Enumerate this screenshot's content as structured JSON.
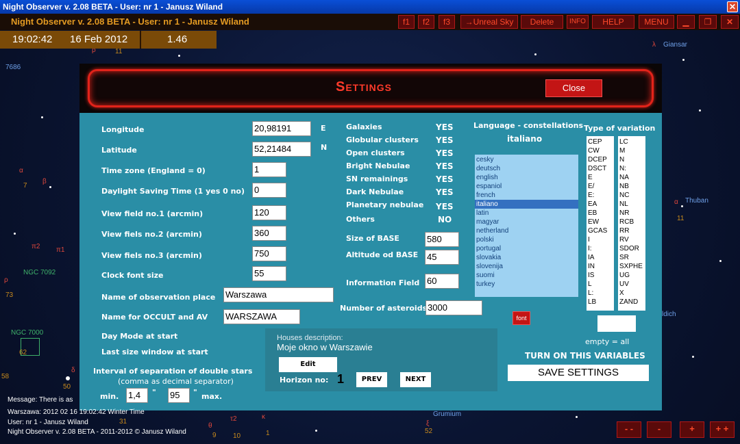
{
  "window": {
    "title": "Night Observer v. 2.08 BETA -  User:  nr 1 - Janusz Wiland"
  },
  "appbar": {
    "title": "Night Observer v. 2.08 BETA -  User:  nr 1 - Janusz Wiland",
    "buttons": [
      "f1",
      "f2",
      "f3",
      "→Unreal Sky",
      "Delete",
      "INFO",
      "HELP",
      "MENU"
    ]
  },
  "timebar": {
    "time": "19:02:42",
    "date": "16 Feb 2012",
    "value": "1.46"
  },
  "sky_labels": {
    "giansar": "Giansar",
    "lambda": "λ",
    "rho": "ρ",
    "eleven": "11",
    "n7686": "7686",
    "alpha1": "α",
    "seven": "7",
    "beta": "β",
    "pi2": "π2",
    "pi1": "π1",
    "ngc7092": "NGC 7092",
    "rho2": "ρ",
    "seventy3": "73",
    "ngc7000": "NGC 7000",
    "sixty2": "62",
    "fifty8": "58",
    "delta": "δ",
    "fifty": "50",
    "thuban": "Thuban",
    "alpha2": "α",
    "eleven2": "11",
    "dich": "ldich",
    "grumium": "Grumium",
    "xi": "ξ",
    "fifty2": "52",
    "theta": "θ",
    "tau2": "τ2",
    "kappa": "κ",
    "thirty1": "31",
    "ten": "10",
    "one": "1",
    "nine": "9"
  },
  "settings": {
    "title": "Settings",
    "close_label": "Close",
    "longitude_label": "Longitude",
    "longitude_value": "20,98191",
    "longitude_dir": "E",
    "latitude_label": "Latitude",
    "latitude_value": "52,21484",
    "latitude_dir": "N",
    "timezone_label": "Time zone (England = 0)",
    "timezone_value": "1",
    "dst_label": "Daylight Saving Time (1 yes  0 no)",
    "dst_value": "0",
    "view1_label": "View field no.1 (arcmin)",
    "view1_value": "120",
    "view2_label": "View fiels no.2 (arcmin)",
    "view2_value": "360",
    "view3_label": "View fiels no.3 (arcmin)",
    "view3_value": "750",
    "clockfont_label": "Clock font size",
    "clockfont_value": "55",
    "obsplace_label": "Name of observation place",
    "obsplace_value": "Warszawa",
    "occult_label": "Name for OCCULT and AV",
    "occult_value": "WARSZAWA",
    "daymode_label": "Day Mode at start",
    "lastsize_label": "Last size window at start",
    "doublestars_label": "Interval of separation of double stars",
    "doublestars_sub": "(comma as decimal separator)",
    "min_label": "min.",
    "min_value": "1,4",
    "min_unit": "\"",
    "max_value": "95",
    "max_unit": "\"",
    "max_label": "max.",
    "objects": [
      {
        "name": "Galaxies",
        "value": "YES"
      },
      {
        "name": "Globular clusters",
        "value": "YES"
      },
      {
        "name": "Open clusters",
        "value": "YES"
      },
      {
        "name": "Bright Nebulae",
        "value": "YES"
      },
      {
        "name": "SN remainings",
        "value": "YES"
      },
      {
        "name": "Dark Nebulae",
        "value": "YES"
      },
      {
        "name": "Planetary nebulae",
        "value": "YES"
      },
      {
        "name": "Others",
        "value": "NO"
      }
    ],
    "base_size_label": "Size of BASE",
    "base_size_value": "580",
    "base_alt_label": "Altitude od BASE",
    "base_alt_value": "45",
    "info_field_label": "Information Field",
    "info_field_value": "60",
    "asteroids_label": "Number of asteroids",
    "asteroids_value": "3000",
    "font_btn": "font",
    "language_label": "Language - constellations",
    "language_selected": "italiano",
    "languages": [
      "cesky",
      "deutsch",
      "english",
      "espaniol",
      "french",
      "italiano",
      "latin",
      "magyar",
      "netherland",
      "polski",
      "portugal",
      "slovakia",
      "slovenija",
      "suomi",
      "turkey"
    ],
    "variation_label": "Type of variation",
    "variation_col1": [
      "CEP",
      "CW",
      "DCEP",
      "DSCT",
      "E",
      "E/",
      "E:",
      "EA",
      "EB",
      "EW",
      "GCAS",
      "I",
      "I:",
      "IA",
      "IN",
      "IS",
      "L",
      "L:",
      "LB"
    ],
    "variation_col2": [
      "LC",
      "M",
      "N",
      "N:",
      "NA",
      "NB",
      "NC",
      "NL",
      "NR",
      "RCB",
      "RR",
      "RV",
      "SDOR",
      "SR",
      "SXPHE",
      "UG",
      "UV",
      "X",
      "ZAND"
    ],
    "empty_all": "empty = all",
    "turn_on": "TURN ON THIS VARIABLES",
    "save_btn": "SAVE SETTINGS",
    "houses_label": "Houses description:",
    "houses_value": "Moje okno w Warszawie",
    "edit_btn": "Edit",
    "horizon_label": "Horizon no:",
    "horizon_value": "1",
    "prev_btn": "PREV",
    "next_btn": "NEXT"
  },
  "status": {
    "message": "Message: There is as",
    "location": "Warszawa:  2012 02 16  19:02:42 Winter Time",
    "user": "User:  nr 1 - Janusz Wiland",
    "copyright": "Night Observer v. 2.08 BETA - 2011-2012 © Janusz Wiland"
  },
  "nav": [
    "- -",
    "-",
    "+",
    "+ +"
  ]
}
